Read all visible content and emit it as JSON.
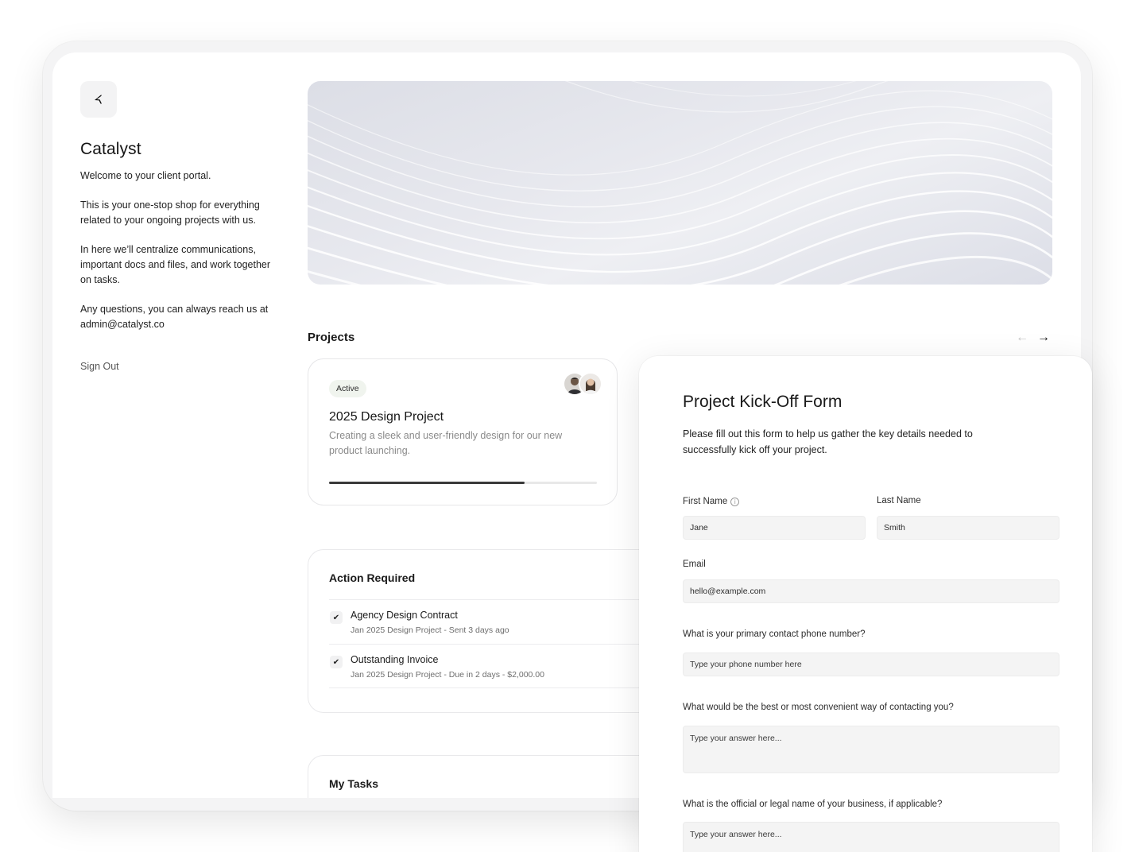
{
  "sidebar": {
    "brand": "Catalyst",
    "welcome": "Welcome to your client portal.",
    "para1": "This is your one-stop shop for everything related to your ongoing projects with us.",
    "para2": "In here we’ll centralize communications, important docs and files, and work together on tasks.",
    "para3": "Any questions, you can always reach us at admin@catalyst.co",
    "sign_out": "Sign Out"
  },
  "projects": {
    "heading": "Projects",
    "card": {
      "status": "Active",
      "title": "2025 Design Project",
      "description": "Creating a sleek and user-friendly design for our new product launching.",
      "progress": 0.73
    }
  },
  "action_required": {
    "heading": "Action Required",
    "items": [
      {
        "name": "Agency Design Contract",
        "meta": "Jan 2025 Design Project - Sent 3 days ago"
      },
      {
        "name": "Outstanding Invoice",
        "meta": "Jan 2025 Design Project - Due in 2 days - $2,000.00"
      }
    ]
  },
  "tasks": {
    "heading": "My Tasks"
  },
  "form": {
    "title": "Project Kick-Off Form",
    "description": "Please fill out this form to help us gather the key details needed to successfully kick off your project.",
    "first_name_label": "First Name",
    "first_name_value": "Jane",
    "last_name_label": "Last Name",
    "last_name_value": "Smith",
    "email_label": "Email",
    "email_value": "hello@example.com",
    "phone_label": "What is your primary contact phone number?",
    "phone_placeholder": "Type your phone number here",
    "contact_label": "What would be the best or most convenient way of contacting you?",
    "contact_placeholder": "Type your answer here...",
    "business_label": "What is the official or legal name of your business, if applicable?",
    "business_placeholder": "Type your answer here..."
  },
  "icons": {
    "logo": "catalyst-logo-icon",
    "prev": "arrow-left-icon",
    "next": "arrow-right-icon",
    "check": "checkmark-icon",
    "info": "info-icon"
  }
}
